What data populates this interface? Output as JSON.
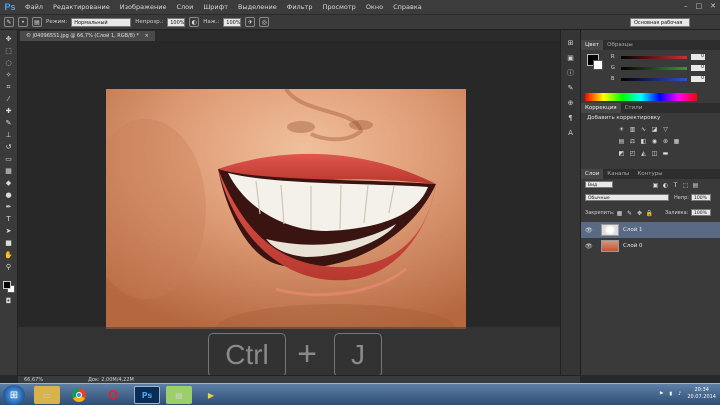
{
  "app": {
    "logo": "Ps",
    "menu": [
      "Файл",
      "Редактирование",
      "Изображение",
      "Слои",
      "Шрифт",
      "Выделение",
      "Фильтр",
      "Просмотр",
      "Окно",
      "Справка"
    ],
    "window_controls": [
      "–",
      "□",
      "✕"
    ]
  },
  "options_bar": {
    "mode_label": "Режим:",
    "mode_value": "Нормальный",
    "opacity_label": "Непрозр.:",
    "opacity_value": "100%",
    "flow_label": "Наж.:",
    "flow_value": "100%",
    "workspace": "Основная рабочая среда"
  },
  "tools": [
    "move-icon",
    "marquee-icon",
    "lasso-icon",
    "quick-select-icon",
    "crop-icon",
    "eyedropper-icon",
    "healing-icon",
    "brush-icon",
    "stamp-icon",
    "history-brush-icon",
    "eraser-icon",
    "gradient-icon",
    "blur-icon",
    "dodge-icon",
    "pen-icon",
    "type-icon",
    "path-select-icon",
    "shape-icon",
    "hand-icon",
    "zoom-icon"
  ],
  "document": {
    "tab_label": "© j04096551.jpg @ 66,7% (Слой 1, RGB/8) *",
    "close": "×"
  },
  "overlay": {
    "key1": "Ctrl",
    "plus": "+",
    "key2": "J"
  },
  "status": {
    "zoom": "66,67%",
    "doc_info": "Док: 2,00М/4,22М"
  },
  "color_panel": {
    "tabs": [
      "Цвет",
      "Образцы"
    ],
    "channels": [
      {
        "label": "R",
        "value": "0",
        "color": "#d03030"
      },
      {
        "label": "G",
        "value": "0",
        "color": "#30a030"
      },
      {
        "label": "B",
        "value": "0",
        "color": "#3050d0"
      }
    ]
  },
  "adjust_panel": {
    "tabs": [
      "Коррекция",
      "Стили"
    ],
    "title": "Добавить корректировку"
  },
  "layers_panel": {
    "tabs": [
      "Слои",
      "Каналы",
      "Контуры"
    ],
    "kind_filter": "Вид",
    "blend_mode": "Обычные",
    "opacity_label": "Непр:",
    "opacity_value": "100%",
    "lock_label": "Закрепить:",
    "fill_label": "Заливка:",
    "fill_value": "100%",
    "layers": [
      {
        "name": "Слой 1",
        "selected": true
      },
      {
        "name": "Слой 0",
        "selected": false
      }
    ]
  },
  "taskbar": {
    "apps": [
      "explorer-icon",
      "chrome-icon",
      "opera-icon",
      "photoshop-icon",
      "archive-icon",
      "video-icon"
    ],
    "time": "20:34",
    "date": "20.07.2014"
  }
}
